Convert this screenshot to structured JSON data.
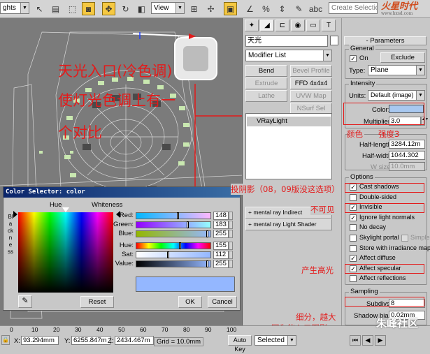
{
  "toolbar": {
    "combo_left": "ghts",
    "view": "View",
    "selection_set": "Create Selection Set"
  },
  "watermark": {
    "logo_text": "火星时代",
    "logo_url": "www.hxsd.com"
  },
  "annotations": {
    "line1": "天光入口(冷色调)",
    "line2": "使灯光色调上有一",
    "line3": "个对比",
    "color_note": "颜色",
    "strength_note": "强度3",
    "shadow_note": "投阴影（08，09版没这选项）",
    "invisible_note": "不可见",
    "specular_note": "产生高光",
    "subdivs_note1": "细分，越大",
    "subdivs_note2": "因为些入口阴影",
    "bottom_wm": "朱峰社区"
  },
  "command_panel": {
    "object_name": "天光",
    "modifier_list": "Modifier List",
    "buttons": [
      {
        "label": "Bend",
        "enabled": true
      },
      {
        "label": "Bevel Profile",
        "enabled": false
      },
      {
        "label": "Extrude",
        "enabled": false
      },
      {
        "label": "FFD 4x4x4",
        "enabled": true
      },
      {
        "label": "Lathe",
        "enabled": false
      },
      {
        "label": "UVW Map",
        "enabled": false
      },
      {
        "label": "NSurf Sel",
        "enabled": false
      }
    ],
    "stack_item": "VRayLight",
    "rollouts": [
      "mental ray Indirect Illumination",
      "mental ray Light Shader"
    ]
  },
  "parameters": {
    "title": "Parameters",
    "general": {
      "label": "General",
      "on_label": "On",
      "on_checked": true,
      "exclude": "Exclude",
      "type_label": "Type:",
      "type_value": "Plane"
    },
    "intensity": {
      "label": "Intensity",
      "units_label": "Units:",
      "units_value": "Default (image)",
      "color_label": "Color:",
      "color_swatch": "#a8c8f0",
      "multiplier_label": "Multiplier:",
      "multiplier": "3.0"
    },
    "size": {
      "label": "Size",
      "half_length_label": "Half-length:",
      "half_length": "3284.12m",
      "half_width_label": "Half-width:",
      "half_width": "1044.302",
      "wsize_label": "W size",
      "wsize": "10.0mm"
    },
    "options": {
      "label": "Options",
      "items": [
        {
          "label": "Cast shadows",
          "checked": true
        },
        {
          "label": "Double-sided",
          "checked": false
        },
        {
          "label": "Invisible",
          "checked": true
        },
        {
          "label": "Ignore light normals",
          "checked": true
        },
        {
          "label": "No decay",
          "checked": false
        },
        {
          "label": "Skylight portal",
          "checked": false,
          "extra": "Simple"
        },
        {
          "label": "Store with irradiance map",
          "checked": false
        },
        {
          "label": "Affect diffuse",
          "checked": true
        },
        {
          "label": "Affect specular",
          "checked": true
        },
        {
          "label": "Affect reflections",
          "checked": false
        }
      ]
    },
    "sampling": {
      "label": "Sampling",
      "subdivs_label": "Subdivs:",
      "subdivs": "8",
      "shadow_bias_label": "Shadow bias:",
      "shadow_bias": "0.02mm"
    }
  },
  "color_dialog": {
    "title": "Color Selector: color",
    "hue": "Hue",
    "whiteness": "Whiteness",
    "blackness": "Blackness",
    "channels": [
      {
        "label": "Red:",
        "value": "148"
      },
      {
        "label": "Green:",
        "value": "183"
      },
      {
        "label": "Blue:",
        "value": "255"
      },
      {
        "label": "Hue:",
        "value": "155"
      },
      {
        "label": "Sat:",
        "value": "112"
      },
      {
        "label": "Value:",
        "value": "255"
      }
    ],
    "swatch": "#94b7ff",
    "reset": "Reset",
    "ok": "OK",
    "cancel": "Cancel"
  },
  "status": {
    "ticks": [
      "0",
      "10",
      "20",
      "30",
      "40",
      "50",
      "60",
      "70",
      "80",
      "90",
      "100"
    ],
    "x_label": "X:",
    "x": "93.294mm",
    "y_label": "Y:",
    "y": "6255.847m",
    "z_label": "Z:",
    "z": "2434.467m",
    "grid": "Grid = 10.0mm",
    "autokey": "Auto Key",
    "selected": "Selected"
  }
}
